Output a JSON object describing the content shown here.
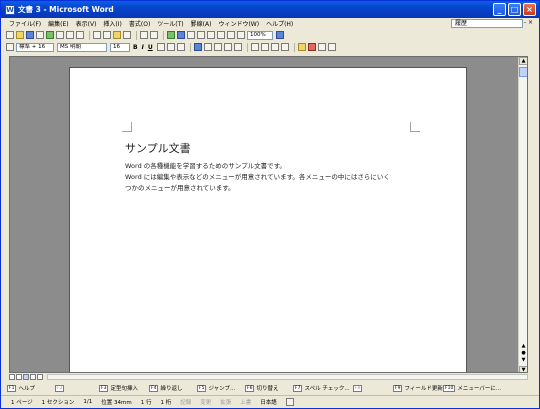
{
  "window": {
    "title": "文書 3 - Microsoft Word",
    "app_icon_letter": "W",
    "min_label": "_",
    "max_label": "□",
    "close_label": "×"
  },
  "menubar": {
    "items": [
      "ファイル(F)",
      "編集(E)",
      "表示(V)",
      "挿入(I)",
      "書式(O)",
      "ツール(T)",
      "罫線(A)",
      "ウィンドウ(W)",
      "ヘルプ(H)"
    ],
    "help_box": "履歴",
    "close": "- ×"
  },
  "toolbar": {
    "zoom": "100%",
    "style": "標準 + 16",
    "font": "MS 明朝",
    "size": "16",
    "bold": "B",
    "italic": "I",
    "underline": "U"
  },
  "document": {
    "heading": "サンプル文書",
    "lines": [
      "Word の各種機能を学習するためのサンプル文書です。",
      "Word には編集や表示などのメニューが用意されています。各メニューの中にはさらにいく",
      "つかのメニューが用意されています。"
    ]
  },
  "fkeys": [
    {
      "num": "F1",
      "label": "ヘルプ",
      "gray": false
    },
    {
      "num": "F2",
      "label": "",
      "gray": true
    },
    {
      "num": "F3",
      "label": "定型句挿入",
      "gray": false
    },
    {
      "num": "F4",
      "label": "繰り返し",
      "gray": false
    },
    {
      "num": "F5",
      "label": "ジャンプ...",
      "gray": false
    },
    {
      "num": "F6",
      "label": "切り替え",
      "gray": false
    },
    {
      "num": "F7",
      "label": "スペル チェック...",
      "gray": false
    },
    {
      "num": "F8",
      "label": "",
      "gray": true
    },
    {
      "num": "F9",
      "label": "フィールド更新",
      "gray": false
    },
    {
      "num": "F10",
      "label": "メニューバーに...",
      "gray": false
    }
  ],
  "statusbar": {
    "page": "1 ページ",
    "section": "1 セクション",
    "pages": "1/1",
    "position": "位置 34mm",
    "line": "1 行",
    "column": "1 桁",
    "rec": "記録",
    "trk": "変更",
    "ext": "拡張",
    "ovr": "上書",
    "lang": "日本語"
  }
}
